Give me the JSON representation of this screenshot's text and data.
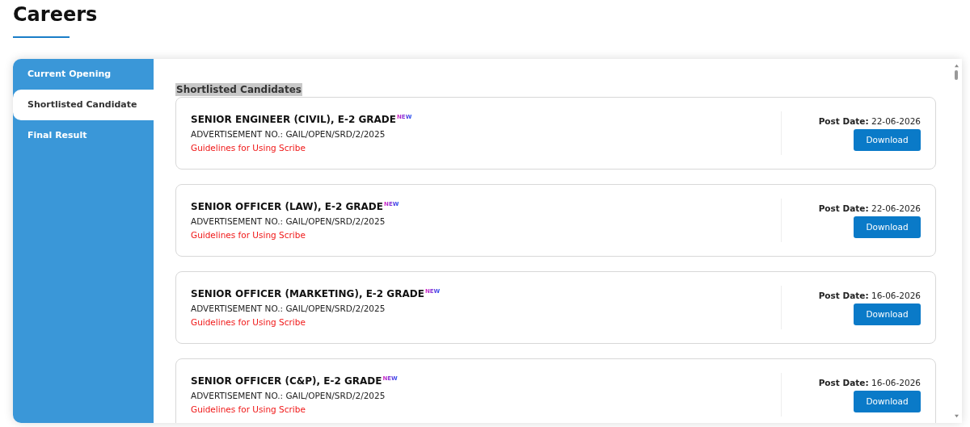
{
  "page_title": "Careers",
  "sidebar": {
    "items": [
      {
        "label": "Current Opening",
        "selected": false
      },
      {
        "label": "Shortlisted Candidate",
        "selected": true
      },
      {
        "label": "Final Result",
        "selected": false
      }
    ]
  },
  "section_title": "Shortlisted Candidates",
  "cards": [
    {
      "title": "SENIOR ENGINEER (CIVIL), E-2 GRADE",
      "badge": "NEW",
      "advertisement": "ADVERTISEMENT NO.: GAIL/OPEN/SRD/2/2025",
      "link": "Guidelines for Using Scribe",
      "date_label": "Post Date:",
      "date": "22-06-2026",
      "button": "Download"
    },
    {
      "title": "SENIOR OFFICER (LAW), E-2 GRADE",
      "badge": "NEW",
      "advertisement": "ADVERTISEMENT NO.: GAIL/OPEN/SRD/2/2025",
      "link": "Guidelines for Using Scribe",
      "date_label": "Post Date:",
      "date": "22-06-2026",
      "button": "Download"
    },
    {
      "title": "SENIOR OFFICER (MARKETING), E-2 GRADE",
      "badge": "NEW",
      "advertisement": "ADVERTISEMENT NO.: GAIL/OPEN/SRD/2/2025",
      "link": "Guidelines for Using Scribe",
      "date_label": "Post Date:",
      "date": "16-06-2026",
      "button": "Download"
    },
    {
      "title": "SENIOR OFFICER (C&P), E-2 GRADE",
      "badge": "NEW",
      "advertisement": "ADVERTISEMENT NO.: GAIL/OPEN/SRD/2/2025",
      "link": "Guidelines for Using Scribe",
      "date_label": "Post Date:",
      "date": "16-06-2026",
      "button": "Download"
    }
  ]
}
